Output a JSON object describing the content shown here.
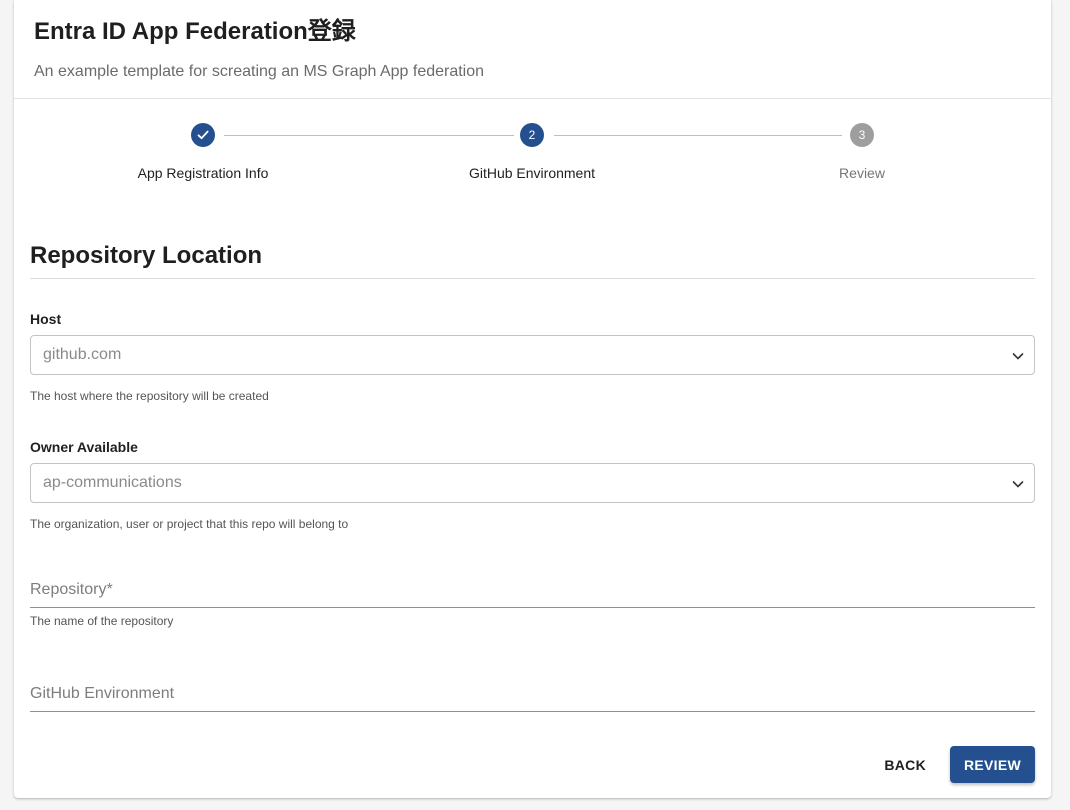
{
  "header": {
    "title": "Entra ID App Federation登録",
    "subtitle": "An example template for screating an MS Graph App federation"
  },
  "stepper": {
    "steps": [
      {
        "number": "1",
        "label": "App Registration Info",
        "state": "done"
      },
      {
        "number": "2",
        "label": "GitHub Environment",
        "state": "active"
      },
      {
        "number": "3",
        "label": "Review",
        "state": "pending"
      }
    ]
  },
  "section": {
    "title": "Repository Location"
  },
  "host": {
    "label": "Host",
    "value": "github.com",
    "helper": "The host where the repository will be created"
  },
  "owner": {
    "label": "Owner Available",
    "value": "ap-communications",
    "helper": "The organization, user or project that this repo will belong to"
  },
  "repository": {
    "label": "Repository*",
    "helper": "The name of the repository"
  },
  "environment": {
    "label": "GitHub Environment"
  },
  "actions": {
    "back_label": "BACK",
    "review_label": "REVIEW"
  },
  "colors": {
    "accent": "#24508f",
    "pending": "#9e9e9e"
  },
  "icons": {
    "done": "check-icon",
    "select": "chevron-down-icon"
  }
}
